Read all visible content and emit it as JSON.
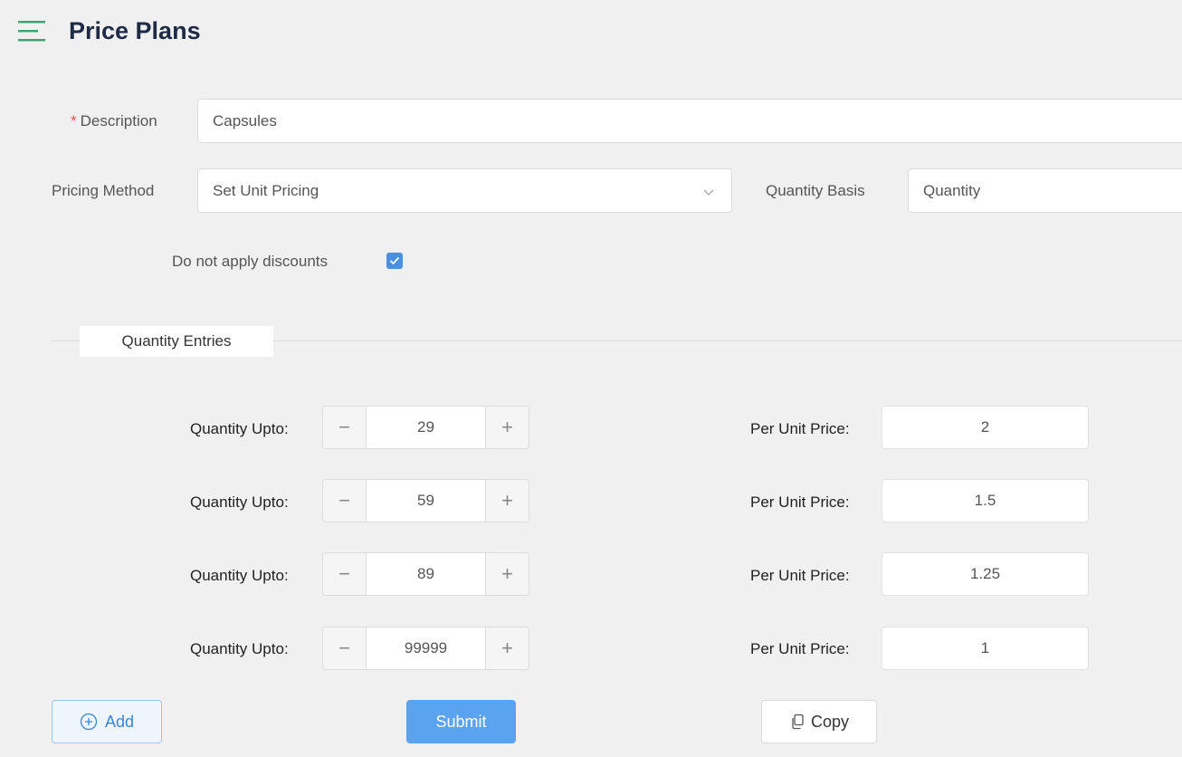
{
  "header": {
    "title": "Price Plans",
    "menu_icon": "hamburger-menu-icon"
  },
  "form": {
    "description": {
      "required_mark": "*",
      "label": "Description",
      "value": "Capsules"
    },
    "pricing_method": {
      "label": "Pricing Method",
      "value": "Set Unit Pricing"
    },
    "quantity_basis": {
      "label": "Quantity Basis",
      "value": "Quantity"
    },
    "discount": {
      "label": "Do not apply discounts",
      "checked": true
    }
  },
  "entries": {
    "section_title": "Quantity Entries",
    "quantity_label": "Quantity Upto:",
    "price_label": "Per Unit Price:",
    "rows": [
      {
        "quantity": "29",
        "price": "2"
      },
      {
        "quantity": "59",
        "price": "1.5"
      },
      {
        "quantity": "89",
        "price": "1.25"
      },
      {
        "quantity": "99999",
        "price": "1"
      }
    ]
  },
  "actions": {
    "add_label": "Add",
    "submit_label": "Submit",
    "copy_label": "Copy"
  },
  "colors": {
    "accent": "#5aa3f0",
    "menu_icon": "#3aa876",
    "title": "#1f2a44",
    "required": "#ff4d4f"
  }
}
